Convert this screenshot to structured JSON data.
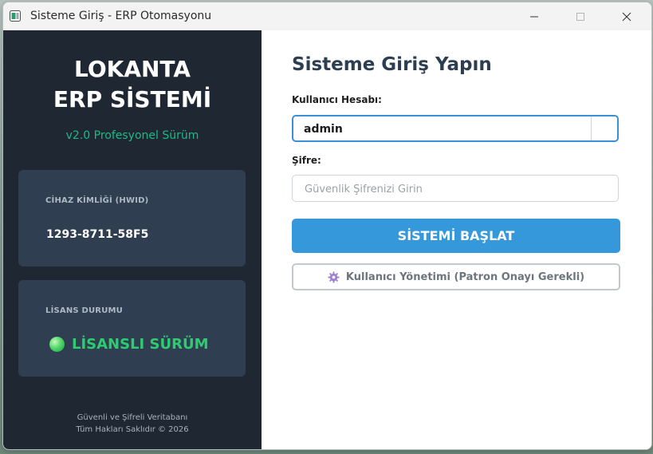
{
  "window": {
    "title": "Sisteme Giriş - ERP Otomasyonu"
  },
  "sidebar": {
    "brand_line1": "LOKANTA",
    "brand_line2": "ERP SİSTEMİ",
    "version": "v2.0 Profesyonel Sürüm",
    "hwid_card": {
      "label": "CİHAZ KİMLİĞİ (HWID)",
      "value": "1293-8711-58F5"
    },
    "license_card": {
      "label": "LİSANS DURUMU",
      "status": "LİSANSLI SÜRÜM",
      "status_color": "#2ecc71"
    },
    "footer_line1": "Güvenli ve Şifreli Veritabanı",
    "footer_line2": "Tüm Hakları Saklıdır © 2026"
  },
  "login": {
    "heading": "Sisteme Giriş Yapın",
    "username_label": "Kullanıcı Hesabı:",
    "username_value": "admin",
    "password_label": "Şifre:",
    "password_placeholder": "Güvenlik Şifrenizi Girin",
    "start_button": "SİSTEMİ BAŞLAT",
    "user_mgmt_button": "Kullanıcı Yönetimi (Patron Onayı Gerekli)",
    "user_mgmt_icon": "gear-icon"
  },
  "colors": {
    "sidebar_bg": "#1f2733",
    "card_bg": "#2f3e50",
    "accent_green": "#1fb985",
    "primary_blue": "#3498db",
    "focus_border": "#3a8fd8"
  }
}
